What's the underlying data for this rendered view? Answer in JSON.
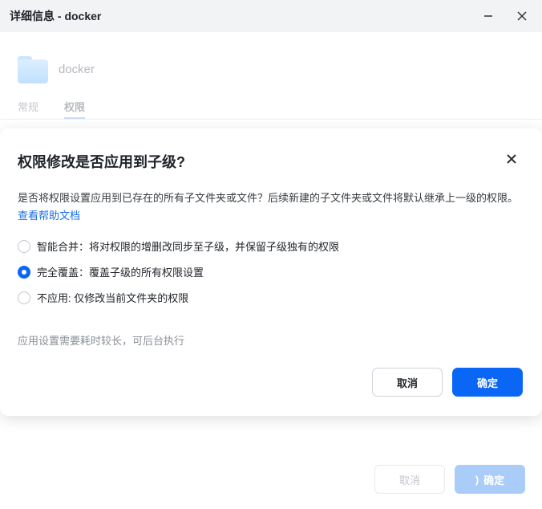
{
  "window": {
    "title": "详细信息 - docker",
    "folder_name": "docker",
    "tabs": [
      {
        "label": "常规"
      },
      {
        "label": "权限"
      }
    ],
    "footer": {
      "cancel_label": "取消",
      "ok_label": "确定"
    }
  },
  "dialog": {
    "title": "权限修改是否应用到子级?",
    "description": "是否将权限设置应用到已存在的所有子文件夹或文件？后续新建的子文件夹或文件将默认继承上一级的权限。",
    "help_link": "查看帮助文档",
    "options": [
      {
        "label": "智能合并：将对权限的增删改同步至子级，并保留子级独有的权限",
        "checked": false
      },
      {
        "label": "完全覆盖：覆盖子级的所有权限设置",
        "checked": true
      },
      {
        "label": "不应用: 仅修改当前文件夹的权限",
        "checked": false
      }
    ],
    "note": "应用设置需要耗时较长，可后台执行",
    "cancel_label": "取消",
    "ok_label": "确定"
  },
  "colors": {
    "accent": "#0a66f4",
    "link": "#1a6fe8"
  }
}
